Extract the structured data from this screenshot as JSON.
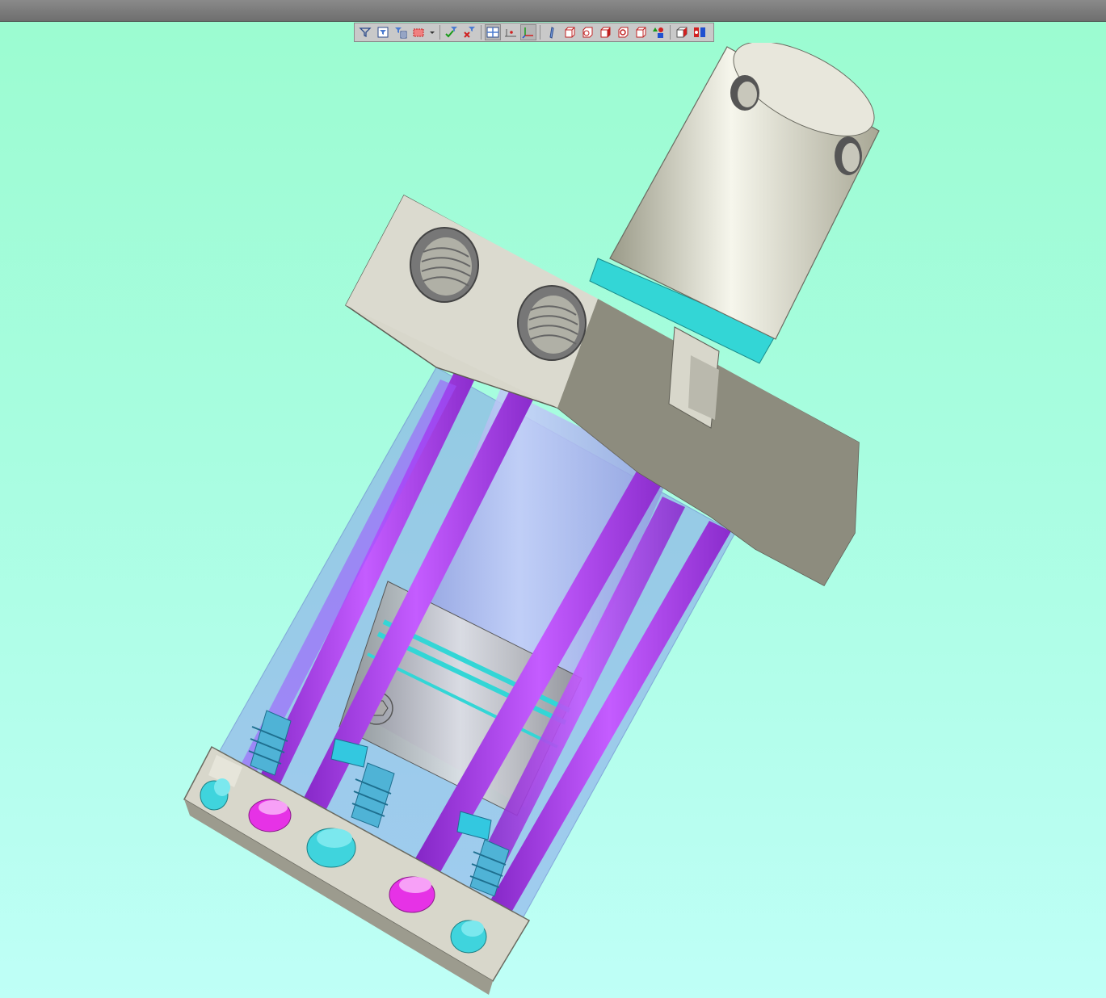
{
  "window": {
    "titlebar": ""
  },
  "toolbar": {
    "buttons": [
      {
        "icon": "filter-icon",
        "group": 1
      },
      {
        "icon": "filter-window-icon",
        "group": 1
      },
      {
        "icon": "filter-list-icon",
        "group": 1
      },
      {
        "icon": "selection-box-icon",
        "group": 1
      },
      {
        "icon": "dropdown-arrow-icon",
        "group": 1
      },
      {
        "icon": "accept-filter-icon",
        "group": 2
      },
      {
        "icon": "clear-filter-icon",
        "group": 2
      },
      {
        "icon": "view-layout-icon",
        "group": 3
      },
      {
        "icon": "point-snap-icon",
        "group": 3
      },
      {
        "icon": "triad-axes-icon",
        "group": 3
      },
      {
        "icon": "sketch-plane-icon",
        "group": 4
      },
      {
        "icon": "solid-body-icon",
        "group": 4
      },
      {
        "icon": "surface-body-icon",
        "group": 4
      },
      {
        "icon": "shaded-cube-icon",
        "group": 4
      },
      {
        "icon": "hidden-lines-icon",
        "group": 4
      },
      {
        "icon": "wireframe-cube-icon",
        "group": 4
      },
      {
        "icon": "primitives-icon",
        "group": 4
      },
      {
        "icon": "appearance-icon",
        "group": 5
      },
      {
        "icon": "scene-settings-icon",
        "group": 5
      }
    ]
  },
  "viewport": {
    "background_top": "#9bfcd0",
    "background_bottom": "#bffff7",
    "colors": {
      "housing": "#d8d7cb",
      "housing_shadow": "#8d8c7e",
      "rod": "#ecebdf",
      "seal_ring": "#33d6d6",
      "tie_rod": "#b14cf5",
      "tie_rod_dark": "#8e39c9",
      "barrel": "#aab6f2",
      "piston": "#c8c8c8",
      "socket_screw_cyan": "#3fd4dd",
      "socket_screw_magenta": "#e632e6",
      "threaded_stud": "#4fb3d6"
    }
  }
}
